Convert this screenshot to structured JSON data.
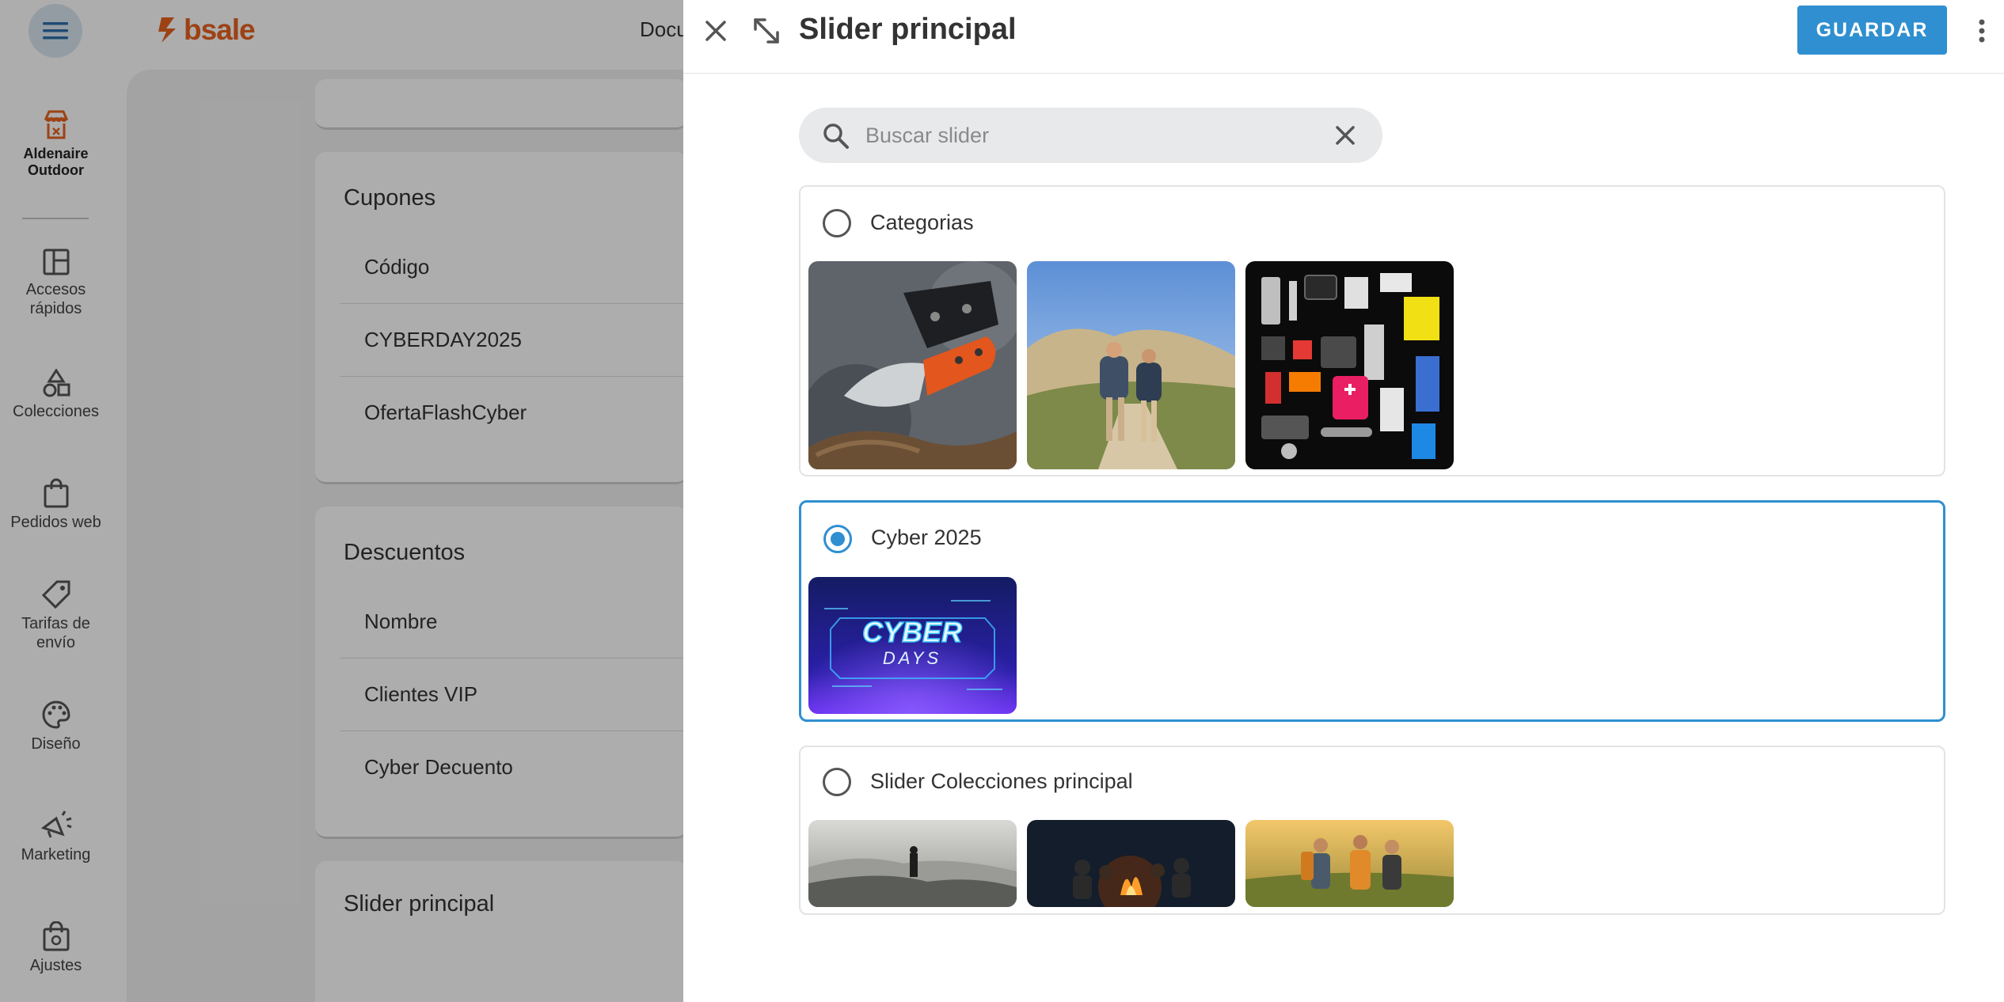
{
  "app": {
    "brand": "bsale",
    "top_nav_partial": "Docu",
    "sidebar": {
      "store": {
        "line1": "Aldenaire",
        "line2": "Outdoor"
      },
      "items": [
        {
          "line1": "Accesos",
          "line2": "rápidos"
        },
        {
          "line1": "Colecciones",
          "line2": ""
        },
        {
          "line1": "Pedidos web",
          "line2": ""
        },
        {
          "line1": "Tarifas de",
          "line2": "envío"
        },
        {
          "line1": "Diseño",
          "line2": ""
        },
        {
          "line1": "Marketing",
          "line2": ""
        },
        {
          "line1": "Ajustes",
          "line2": ""
        }
      ]
    },
    "cards": {
      "cupones": {
        "title": "Cupones",
        "header": "Código",
        "rows": [
          "CYBERDAY2025",
          "OfertaFlashCyber"
        ]
      },
      "descuentos": {
        "title": "Descuentos",
        "header": "Nombre",
        "rows": [
          "Clientes VIP",
          "Cyber Decuento"
        ]
      },
      "slider": {
        "title": "Slider principal"
      }
    }
  },
  "drawer": {
    "title": "Slider principal",
    "save_label": "GUARDAR",
    "search": {
      "placeholder": "Buscar slider",
      "value": ""
    },
    "options": [
      {
        "label": "Categorias",
        "selected": false,
        "image_count": 3
      },
      {
        "label": "Cyber 2025",
        "selected": true,
        "image_count": 1,
        "banner_line1": "CYBER",
        "banner_line2": "DAYS"
      },
      {
        "label": "Slider Colecciones principal",
        "selected": false,
        "image_count": 3
      }
    ]
  },
  "colors": {
    "accent": "#2f8fd0",
    "brand": "#e8621f",
    "overlay": "rgba(0,0,0,0.32)"
  }
}
